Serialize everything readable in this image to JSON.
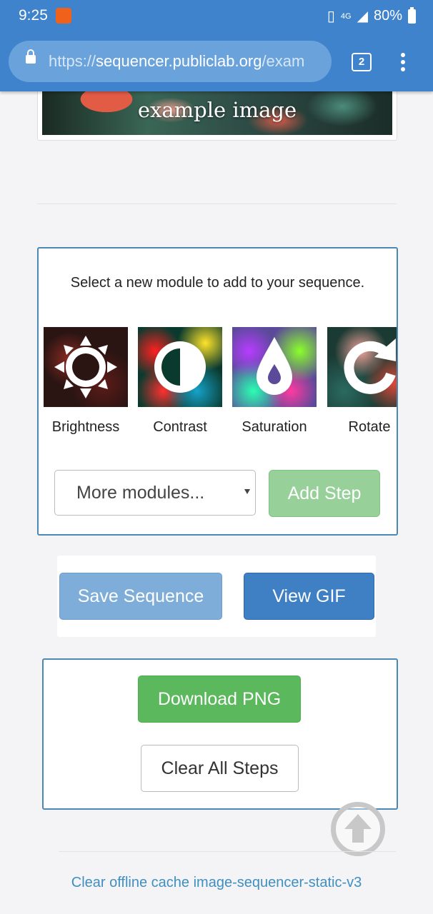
{
  "status_bar": {
    "time": "9:25",
    "network": "4G",
    "battery": "80%"
  },
  "browser": {
    "url_scheme": "https://",
    "url_host": "sequencer.publiclab.org",
    "url_path": "/exam",
    "tab_count": "2"
  },
  "preview": {
    "caption": "example image"
  },
  "module_panel": {
    "prompt": "Select a new module to add to your sequence.",
    "modules": [
      {
        "label": "Brightness",
        "icon": "sun-icon"
      },
      {
        "label": "Contrast",
        "icon": "contrast-icon"
      },
      {
        "label": "Saturation",
        "icon": "drop-icon"
      },
      {
        "label": "Rotate",
        "icon": "rotate-icon"
      }
    ],
    "select_value": "More modules...",
    "add_step_label": "Add Step"
  },
  "sequence_actions": {
    "save_label": "Save Sequence",
    "view_gif_label": "View GIF"
  },
  "download_panel": {
    "download_label": "Download PNG",
    "clear_label": "Clear All Steps"
  },
  "footer": {
    "cache_link": "Clear offline cache image-sequencer-static-v3"
  },
  "colors": {
    "primary": "#3f7fc4",
    "success": "#5cb85c",
    "chrome": "#3f83cc",
    "panel_border": "#4d87b4"
  }
}
